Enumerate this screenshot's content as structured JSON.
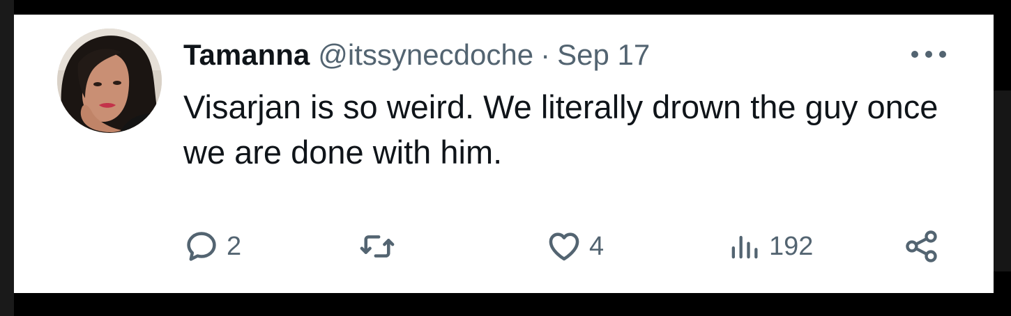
{
  "tweet": {
    "author": {
      "display_name": "Tamanna",
      "handle": "@itssynecdoche",
      "avatar_icon": "profile-photo"
    },
    "separator": "·",
    "date": "Sep 17",
    "more_icon": "more-horizontal-icon",
    "text": "Visarjan is so weird. We literally drown the guy once we are done with him.",
    "stats": {
      "replies": "2",
      "retweets": "",
      "likes": "4",
      "views": "192"
    },
    "icons": {
      "reply": "reply-icon",
      "retweet": "retweet-icon",
      "like": "heart-icon",
      "views": "views-icon",
      "share": "share-icon"
    },
    "colors": {
      "text": "#0f1419",
      "muted": "#536471",
      "background": "#ffffff",
      "frame": "#000000"
    }
  }
}
